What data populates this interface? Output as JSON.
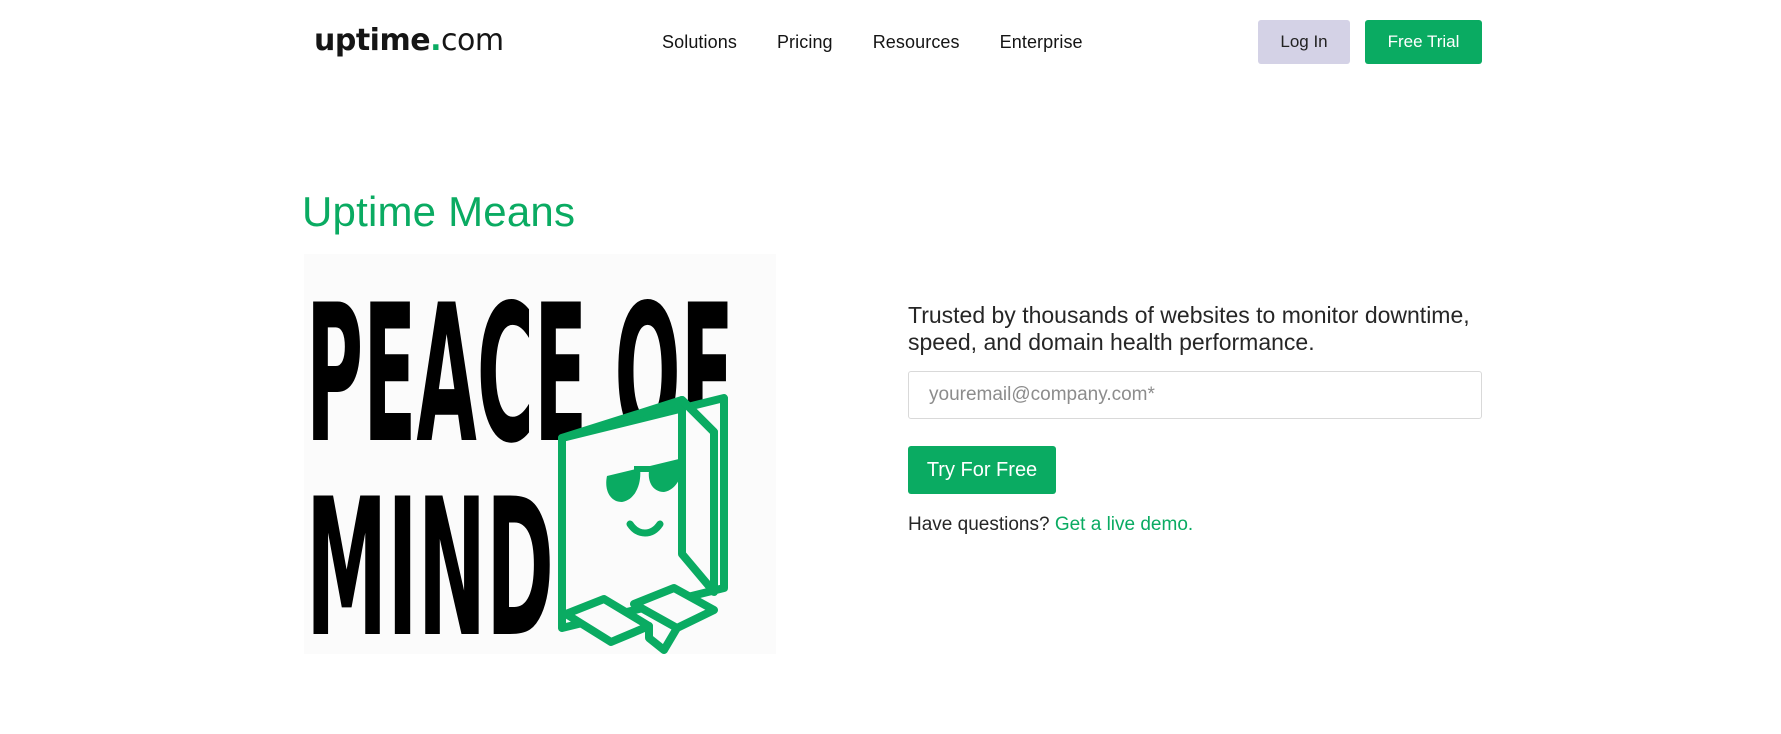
{
  "header": {
    "logo": {
      "main": "uptime",
      "dot": ".",
      "tld": "com"
    },
    "nav": [
      {
        "label": "Solutions"
      },
      {
        "label": "Pricing"
      },
      {
        "label": "Resources"
      },
      {
        "label": "Enterprise"
      }
    ],
    "login_label": "Log In",
    "trial_label": "Free Trial"
  },
  "hero": {
    "eyebrow": "Uptime Means",
    "graphic_text": "PEACE OF MIND",
    "graphic_icon": "sunglasses-box-icon",
    "tagline": "Trusted by thousands of websites to monitor downtime, speed, and domain health performance.",
    "email_placeholder": "youremail@company.com*",
    "cta_label": "Try For Free",
    "questions_text": "Have questions?",
    "demo_link_label": "Get a live demo."
  },
  "colors": {
    "brand_green": "#0aab62",
    "login_bg": "#d4d2e6",
    "text_dark": "#141414"
  }
}
